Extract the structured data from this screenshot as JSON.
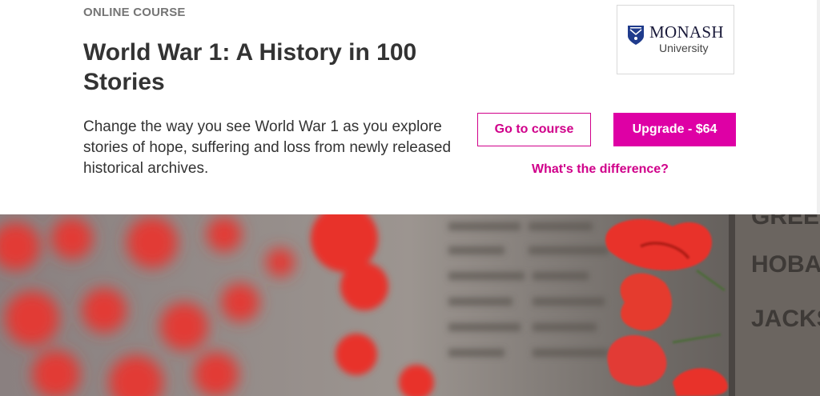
{
  "course": {
    "eyebrow": "ONLINE COURSE",
    "title": "World War 1: A History in 100 Stories",
    "description": "Change the way you see World War 1 as you explore stories of hope, suffering and loss from newly released historical archives."
  },
  "provider": {
    "name": "MONASH",
    "subtitle": "University",
    "logo_icon": "crest-icon"
  },
  "actions": {
    "go_to_course": "Go to course",
    "upgrade": "Upgrade - $64",
    "difference_link": "What's the difference?"
  },
  "hero": {
    "wall_names": [
      "GREEN",
      "HOBAN",
      "JACKS"
    ],
    "poppy_color": "#e8322a",
    "wall_color": "#7a7470"
  },
  "colors": {
    "accent": "#d0008a",
    "upgrade_bg": "#de00a5"
  }
}
